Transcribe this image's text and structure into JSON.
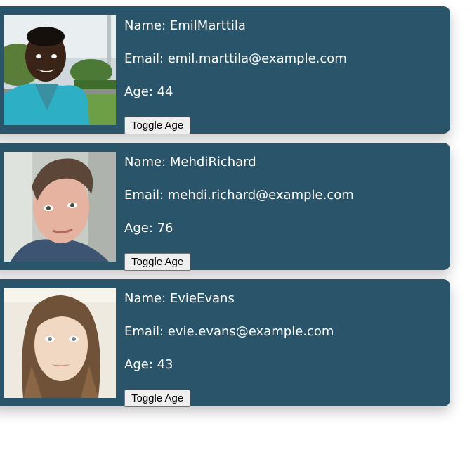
{
  "cards": [
    {
      "name_label": "Name: EmilMarttila",
      "email_label": "Email: emil.marttila@example.com",
      "age_label": "Age: 44",
      "button_label": "Toggle Age"
    },
    {
      "name_label": "Name: MehdiRichard",
      "email_label": "Email: mehdi.richard@example.com",
      "age_label": "Age: 76",
      "button_label": "Toggle Age"
    },
    {
      "name_label": "Name: EvieEvans",
      "email_label": "Email: evie.evans@example.com",
      "age_label": "Age: 43",
      "button_label": "Toggle Age"
    }
  ],
  "colors": {
    "card_background": "#2a5469",
    "card_text": "#ffffff",
    "button_background": "#efefef"
  }
}
